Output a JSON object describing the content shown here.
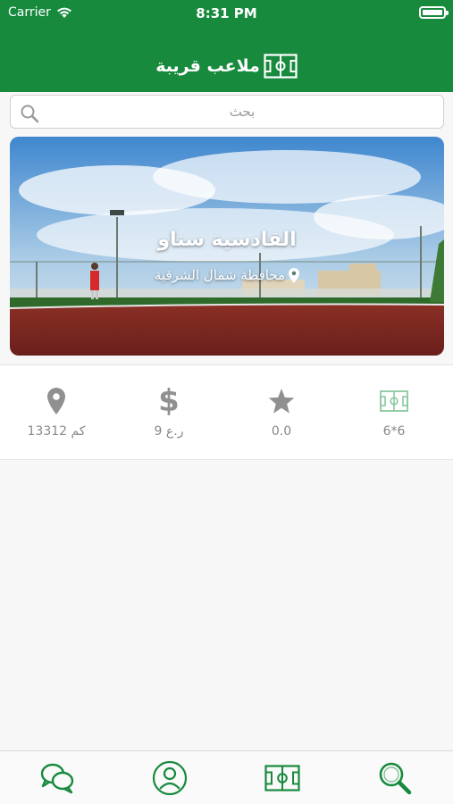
{
  "status_bar": {
    "carrier": "Carrier",
    "time": "8:31 PM"
  },
  "nav": {
    "title": "ملاعب قريبة",
    "title_icon": "field-icon"
  },
  "search": {
    "placeholder": "بحث",
    "icon": "search-icon"
  },
  "venue": {
    "name": "القادسية سناو",
    "location": "محافظة شمال الشرقية",
    "location_icon": "location-pin-icon"
  },
  "stats": [
    {
      "icon": "location-pin-icon",
      "value": "13312 كم"
    },
    {
      "icon": "dollar-icon",
      "value": "9 ر.ع"
    },
    {
      "icon": "star-icon",
      "value": "0.0"
    },
    {
      "icon": "field-icon",
      "value": "6*6"
    }
  ],
  "tabbar": [
    {
      "icon": "chat-icon"
    },
    {
      "icon": "profile-icon"
    },
    {
      "icon": "field-icon"
    },
    {
      "icon": "search-icon"
    }
  ],
  "colors": {
    "primary": "#178a3e",
    "stat_gray": "#888888",
    "field_icon_light": "#8ac9a1"
  }
}
